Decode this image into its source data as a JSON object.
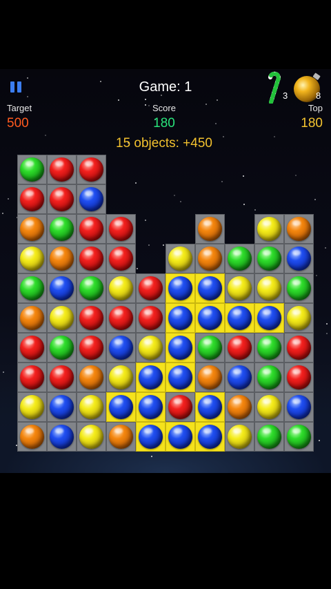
{
  "header": {
    "game_title": "Game: 1",
    "target_label": "Target",
    "target_value": "500",
    "score_label": "Score",
    "score_value": "180",
    "top_label": "Top",
    "top_value": "180",
    "bonus_text": "15 objects: +450",
    "candy_cane_count": "3",
    "ornament_count": "8"
  },
  "icons": {
    "pause": "pause-icon",
    "candy_cane": "candy-cane-icon",
    "ornament": "ornament-icon"
  },
  "colors": {
    "target": "#ff5a1f",
    "score": "#29e37a",
    "top": "#f4c430",
    "bonus": "#f2c12e",
    "selection": "#f5e21c"
  },
  "board": {
    "columns": 10,
    "rows": 10,
    "grid": [
      [
        "green",
        "red",
        "red",
        null,
        null,
        null,
        null,
        null,
        null,
        null
      ],
      [
        "red",
        "red",
        "blue",
        null,
        null,
        null,
        null,
        null,
        null,
        null
      ],
      [
        "orange",
        "green",
        "red",
        "red",
        null,
        null,
        "orange",
        null,
        "yellow",
        "orange"
      ],
      [
        "yellow",
        "orange",
        "red",
        "red",
        null,
        "yellow",
        "orange",
        "green",
        "green",
        "blue"
      ],
      [
        "green",
        "blue",
        "green",
        "yellow",
        "red",
        "blue",
        "blue",
        "yellow",
        "yellow",
        "green"
      ],
      [
        "orange",
        "yellow",
        "red",
        "red",
        "red",
        "blue",
        "blue",
        "blue",
        "blue",
        "yellow"
      ],
      [
        "red",
        "green",
        "red",
        "blue",
        "yellow",
        "blue",
        "green",
        "red",
        "green",
        "red"
      ],
      [
        "red",
        "red",
        "orange",
        "yellow",
        "blue",
        "blue",
        "orange",
        "blue",
        "green",
        "red"
      ],
      [
        "yellow",
        "blue",
        "yellow",
        "blue",
        "blue",
        "red",
        "blue",
        "orange",
        "yellow",
        "blue"
      ],
      [
        "orange",
        "blue",
        "yellow",
        "orange",
        "blue",
        "blue",
        "blue",
        "yellow",
        "green",
        "green"
      ]
    ],
    "selected": [
      [
        4,
        5
      ],
      [
        4,
        6
      ],
      [
        5,
        5
      ],
      [
        5,
        6
      ],
      [
        5,
        7
      ],
      [
        5,
        8
      ],
      [
        6,
        5
      ],
      [
        7,
        4
      ],
      [
        7,
        5
      ],
      [
        8,
        3
      ],
      [
        8,
        4
      ],
      [
        8,
        6
      ],
      [
        9,
        4
      ],
      [
        9,
        5
      ],
      [
        9,
        6
      ]
    ]
  }
}
